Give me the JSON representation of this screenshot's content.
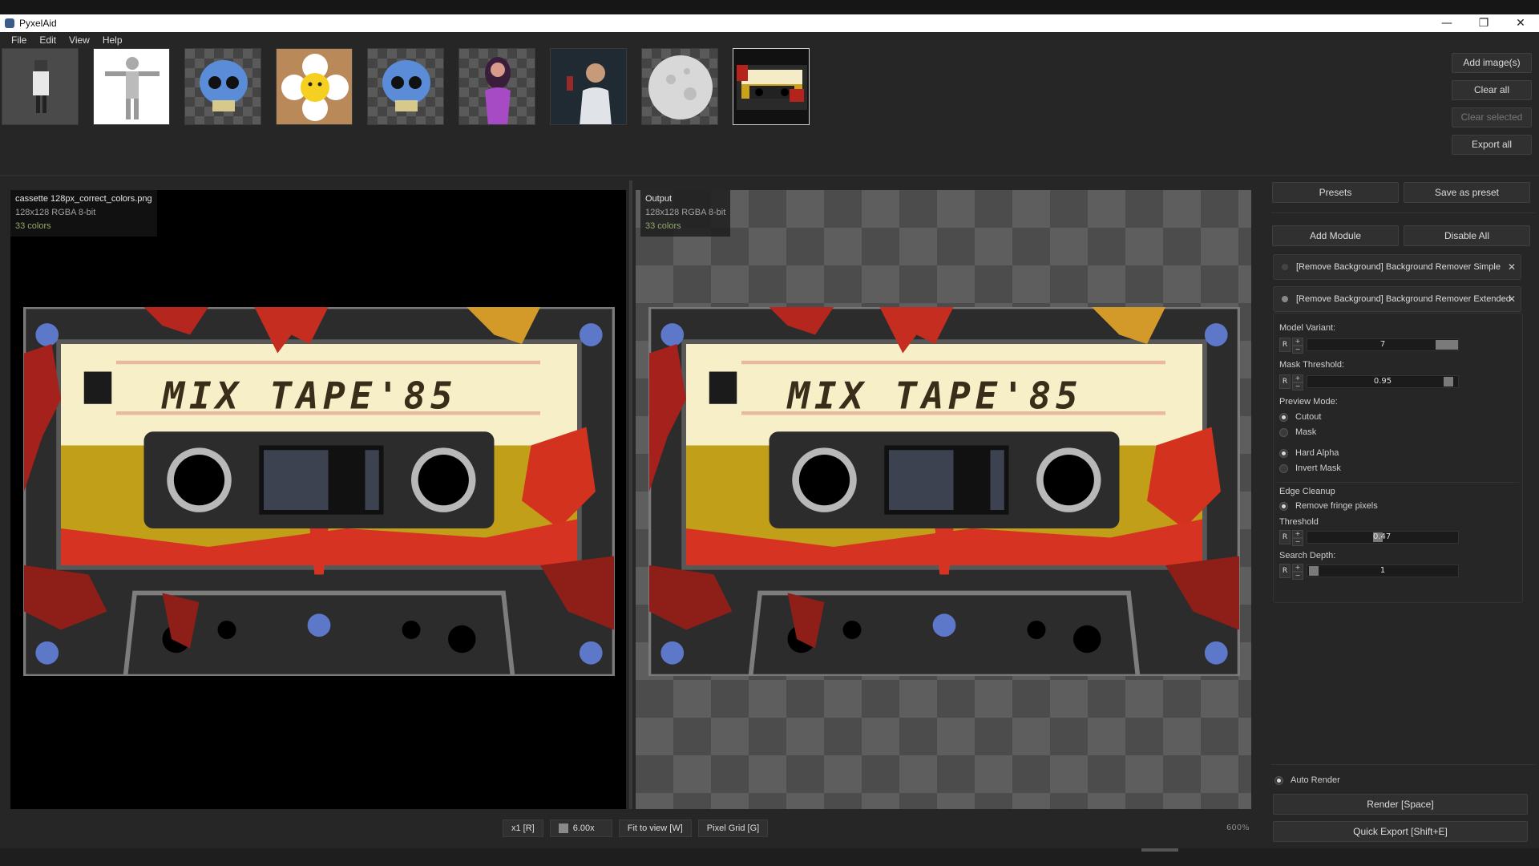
{
  "window": {
    "title": "PyxelAid",
    "minimize": "—",
    "maximize": "❐",
    "close": "✕"
  },
  "menu": [
    "File",
    "Edit",
    "View",
    "Help"
  ],
  "thumbnails": [
    {
      "name": "character-figure"
    },
    {
      "name": "girl-tpose"
    },
    {
      "name": "skull-blue"
    },
    {
      "name": "flower-smiley"
    },
    {
      "name": "skull-blue-2"
    },
    {
      "name": "woman-purple"
    },
    {
      "name": "scientist-photo"
    },
    {
      "name": "moon-sphere"
    },
    {
      "name": "mixtape-cassette",
      "selected": true
    }
  ],
  "gallery_buttons": {
    "add": "Add image(s)",
    "clear_all": "Clear all",
    "clear_selected": "Clear selected",
    "export_all": "Export all"
  },
  "input_pane": {
    "filename": "cassette 128px_correct_colors.png",
    "meta": "128x128  RGBA  8-bit",
    "colors": "33 colors"
  },
  "output_pane": {
    "filename": "Output",
    "meta": "128x128  RGBA  8-bit",
    "colors": "33 colors"
  },
  "cassette_text": "MIX TAPE'85",
  "bottom_bar": {
    "scale": "x1 [R]",
    "zoom": "6.00x",
    "fit": "Fit to view [W]",
    "grid": "Pixel Grid [G]",
    "zoom_pct": "600%"
  },
  "right_panel": {
    "presets": "Presets",
    "save_preset": "Save as preset",
    "add_module": "Add Module",
    "disable_all": "Disable All",
    "modules": [
      "[Remove Background] Background Remover Simple",
      "[Remove Background] Background Remover Extended"
    ],
    "module_close": "✕",
    "model_variant_label": "Model Variant:",
    "model_variant_value": "7",
    "mask_threshold_label": "Mask Threshold:",
    "mask_threshold_value": "0.95",
    "preview_mode_label": "Preview Mode:",
    "cutout": "Cutout",
    "mask": "Mask",
    "hard_alpha": "Hard Alpha",
    "invert_mask": "Invert Mask",
    "edge_cleanup": "Edge Cleanup",
    "remove_fringe": "Remove fringe pixels",
    "threshold_label": "Threshold",
    "threshold_value": "0.47",
    "search_depth_label": "Search Depth:",
    "search_depth_value": "1",
    "r": "R",
    "plus": "+",
    "minus": "−",
    "auto_render": "Auto Render",
    "render": "Render  [Space]",
    "quick_export": "Quick Export  [Shift+E]"
  }
}
